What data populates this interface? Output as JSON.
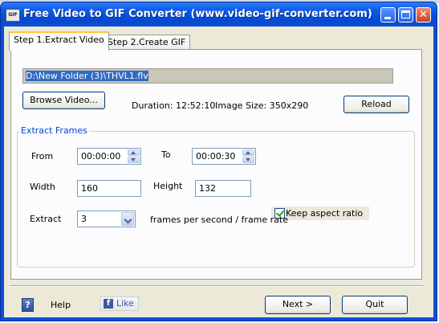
{
  "window": {
    "title": "Free Video to GIF Converter (www.video-gif-converter.com)",
    "icon_text": "GIF",
    "controls": [
      "minimize-icon",
      "maximize-icon",
      "close-icon"
    ],
    "close_glyph": "✕"
  },
  "tabs": [
    {
      "label": "Step 1.Extract Video",
      "active": true
    },
    {
      "label": "Step 2.Create GIF",
      "active": false
    }
  ],
  "extract_video": {
    "file_path": "D:\\New Folder (3)\\THVL1.flv",
    "browse_label": "Browse Video...",
    "duration_text": "Duration: 12:52:10",
    "image_size_text": "Image Size: 350x290",
    "reload_label": "Reload"
  },
  "extract_frames": {
    "legend": "Extract Frames",
    "from_label": "From",
    "from_value": "00:00:00",
    "to_label": "To",
    "to_value": "00:00:30",
    "width_label": "Width",
    "width_value": "160",
    "height_label": "Height",
    "height_value": "132",
    "keep_aspect_label": "Keep aspect ratio",
    "keep_aspect_checked": true,
    "extract_label": "Extract",
    "extract_value": "3",
    "frame_rate_label": "frames per second / frame rate"
  },
  "footer": {
    "help_icon_glyph": "?",
    "help_label": "Help",
    "like_icon_glyph": "f",
    "like_label": "Like",
    "next_label": "Next >",
    "quit_label": "Quit"
  },
  "colors": {
    "titlebar": "#0a5ae8",
    "client_bg": "#ece9d8",
    "group_legend": "#0046d5",
    "selection": "#316ac5"
  }
}
